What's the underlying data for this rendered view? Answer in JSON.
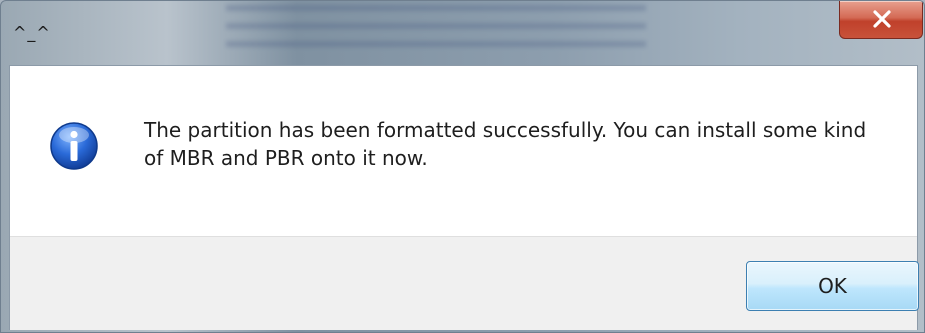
{
  "window": {
    "title": "^_^"
  },
  "titlebar": {
    "close_icon": "close-x-icon"
  },
  "dialog": {
    "icon": "information-icon",
    "message": "The partition has been formatted successfully. You can install some kind of MBR and PBR onto it now.",
    "ok_label": "OK"
  },
  "colors": {
    "close_button_red": "#c8523a",
    "ok_button_border": "#3c7fb1",
    "info_icon_blue": "#1f5fc4",
    "button_bar_bg": "#f0f0f0"
  }
}
